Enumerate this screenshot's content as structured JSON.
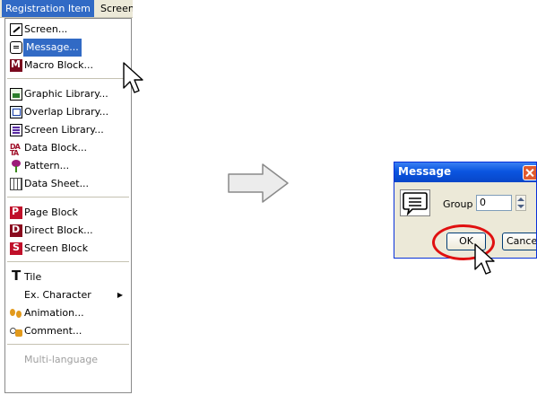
{
  "menubar": {
    "active_menu": "Registration Item",
    "next_menu": "Screen"
  },
  "menu": {
    "items": [
      {
        "label": "Screen...",
        "icon": "screen-icon"
      },
      {
        "label": "Message...",
        "icon": "message-icon"
      },
      {
        "label": "Macro Block...",
        "icon": "macro-block-icon"
      },
      {
        "label": "Graphic Library...",
        "icon": "graphic-library-icon"
      },
      {
        "label": "Overlap Library...",
        "icon": "overlap-library-icon"
      },
      {
        "label": "Screen Library...",
        "icon": "screen-library-icon"
      },
      {
        "label": "Data Block...",
        "icon": "data-block-icon"
      },
      {
        "label": "Pattern...",
        "icon": "pattern-icon"
      },
      {
        "label": "Data Sheet...",
        "icon": "data-sheet-icon"
      },
      {
        "label": "Page Block",
        "icon": "page-block-icon"
      },
      {
        "label": "Direct Block...",
        "icon": "direct-block-icon"
      },
      {
        "label": "Screen Block",
        "icon": "screen-block-icon"
      },
      {
        "label": "Tile",
        "icon": "tile-icon"
      },
      {
        "label": "Ex. Character",
        "icon": "none"
      },
      {
        "label": "Animation...",
        "icon": "animation-icon"
      },
      {
        "label": "Comment...",
        "icon": "comment-icon"
      },
      {
        "label": "Multi-language",
        "icon": "none"
      }
    ],
    "highlighted": "Message...",
    "disabled": "Multi-language"
  },
  "dialog": {
    "title": "Message",
    "group_label": "Group",
    "group_value": "0",
    "ok_label": "OK",
    "cancel_label": "Cancel"
  },
  "colors": {
    "menu_highlight": "#316ac5",
    "title_bar": "#0a55e0",
    "highlight_ring": "#e01010"
  }
}
